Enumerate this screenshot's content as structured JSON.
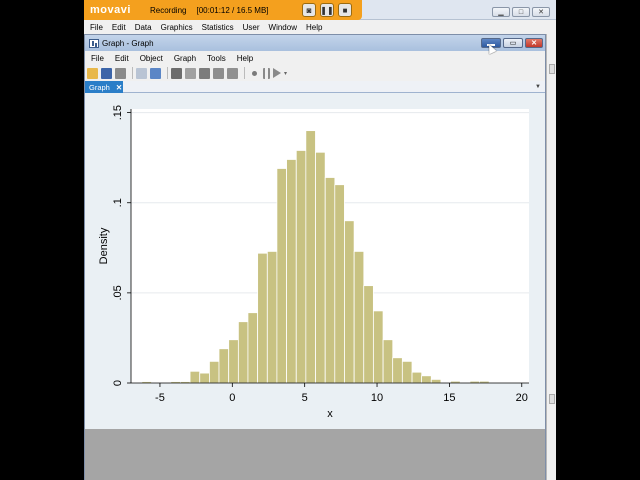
{
  "recorder": {
    "logo": "movavi",
    "status": "Recording",
    "time": "[00:01:12 / 16.5 MB]"
  },
  "main_window": {
    "menu": [
      "File",
      "Edit",
      "Data",
      "Graphics",
      "Statistics",
      "User",
      "Window",
      "Help"
    ]
  },
  "graph_window": {
    "title": "Graph - Graph",
    "menu": [
      "File",
      "Edit",
      "Object",
      "Graph",
      "Tools",
      "Help"
    ],
    "tab": "Graph",
    "tab_close": "✕"
  },
  "colors": {
    "bar_fill": "#c8c282",
    "bar_stroke": "#ffffff",
    "plot_bg": "#ffffff",
    "outer_bg": "#eaf0f4",
    "movavi_orange": "#f4a01e",
    "tab_blue": "#2a7ec8"
  },
  "chart_data": {
    "type": "bar",
    "xlabel": "x",
    "ylabel": "Density",
    "xlim": [
      -7,
      20.5
    ],
    "ylim": [
      0,
      0.152
    ],
    "x_ticks": [
      -5,
      0,
      5,
      10,
      15,
      20
    ],
    "x_tick_labels": [
      "-5",
      "0",
      "5",
      "10",
      "15",
      "20"
    ],
    "y_ticks": [
      0,
      0.05,
      0.1,
      0.15
    ],
    "y_tick_labels": [
      "0",
      ".05",
      ".1",
      ".15"
    ],
    "grid": true,
    "bin_width": 0.6667,
    "bin_left_edges": [
      -6.25,
      -4.25,
      -3.58,
      -2.92,
      -2.25,
      -1.58,
      -0.92,
      -0.25,
      0.42,
      1.08,
      1.75,
      2.42,
      3.08,
      3.75,
      4.42,
      5.08,
      5.75,
      6.42,
      7.08,
      7.75,
      8.42,
      9.08,
      9.75,
      10.42,
      11.08,
      11.75,
      12.42,
      13.08,
      13.75,
      15.08,
      16.42,
      17.08
    ],
    "values": [
      0.0008,
      0.0008,
      0.0008,
      0.0065,
      0.0055,
      0.012,
      0.019,
      0.024,
      0.034,
      0.039,
      0.072,
      0.073,
      0.119,
      0.124,
      0.129,
      0.14,
      0.128,
      0.114,
      0.11,
      0.09,
      0.073,
      0.054,
      0.04,
      0.024,
      0.014,
      0.012,
      0.006,
      0.004,
      0.002,
      0.001,
      0.001,
      0.001
    ]
  }
}
